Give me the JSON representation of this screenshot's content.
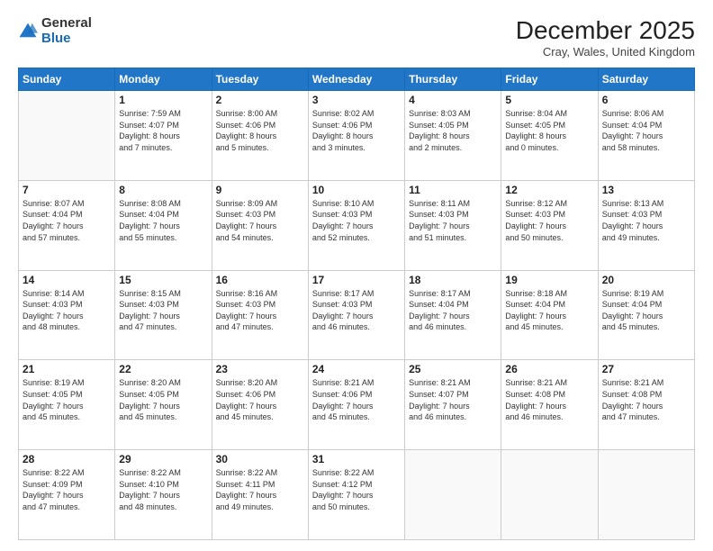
{
  "logo": {
    "general": "General",
    "blue": "Blue"
  },
  "title": "December 2025",
  "subtitle": "Cray, Wales, United Kingdom",
  "headers": [
    "Sunday",
    "Monday",
    "Tuesday",
    "Wednesday",
    "Thursday",
    "Friday",
    "Saturday"
  ],
  "weeks": [
    [
      {
        "day": "",
        "info": ""
      },
      {
        "day": "1",
        "info": "Sunrise: 7:59 AM\nSunset: 4:07 PM\nDaylight: 8 hours\nand 7 minutes."
      },
      {
        "day": "2",
        "info": "Sunrise: 8:00 AM\nSunset: 4:06 PM\nDaylight: 8 hours\nand 5 minutes."
      },
      {
        "day": "3",
        "info": "Sunrise: 8:02 AM\nSunset: 4:06 PM\nDaylight: 8 hours\nand 3 minutes."
      },
      {
        "day": "4",
        "info": "Sunrise: 8:03 AM\nSunset: 4:05 PM\nDaylight: 8 hours\nand 2 minutes."
      },
      {
        "day": "5",
        "info": "Sunrise: 8:04 AM\nSunset: 4:05 PM\nDaylight: 8 hours\nand 0 minutes."
      },
      {
        "day": "6",
        "info": "Sunrise: 8:06 AM\nSunset: 4:04 PM\nDaylight: 7 hours\nand 58 minutes."
      }
    ],
    [
      {
        "day": "7",
        "info": "Sunrise: 8:07 AM\nSunset: 4:04 PM\nDaylight: 7 hours\nand 57 minutes."
      },
      {
        "day": "8",
        "info": "Sunrise: 8:08 AM\nSunset: 4:04 PM\nDaylight: 7 hours\nand 55 minutes."
      },
      {
        "day": "9",
        "info": "Sunrise: 8:09 AM\nSunset: 4:03 PM\nDaylight: 7 hours\nand 54 minutes."
      },
      {
        "day": "10",
        "info": "Sunrise: 8:10 AM\nSunset: 4:03 PM\nDaylight: 7 hours\nand 52 minutes."
      },
      {
        "day": "11",
        "info": "Sunrise: 8:11 AM\nSunset: 4:03 PM\nDaylight: 7 hours\nand 51 minutes."
      },
      {
        "day": "12",
        "info": "Sunrise: 8:12 AM\nSunset: 4:03 PM\nDaylight: 7 hours\nand 50 minutes."
      },
      {
        "day": "13",
        "info": "Sunrise: 8:13 AM\nSunset: 4:03 PM\nDaylight: 7 hours\nand 49 minutes."
      }
    ],
    [
      {
        "day": "14",
        "info": "Sunrise: 8:14 AM\nSunset: 4:03 PM\nDaylight: 7 hours\nand 48 minutes."
      },
      {
        "day": "15",
        "info": "Sunrise: 8:15 AM\nSunset: 4:03 PM\nDaylight: 7 hours\nand 47 minutes."
      },
      {
        "day": "16",
        "info": "Sunrise: 8:16 AM\nSunset: 4:03 PM\nDaylight: 7 hours\nand 47 minutes."
      },
      {
        "day": "17",
        "info": "Sunrise: 8:17 AM\nSunset: 4:03 PM\nDaylight: 7 hours\nand 46 minutes."
      },
      {
        "day": "18",
        "info": "Sunrise: 8:17 AM\nSunset: 4:04 PM\nDaylight: 7 hours\nand 46 minutes."
      },
      {
        "day": "19",
        "info": "Sunrise: 8:18 AM\nSunset: 4:04 PM\nDaylight: 7 hours\nand 45 minutes."
      },
      {
        "day": "20",
        "info": "Sunrise: 8:19 AM\nSunset: 4:04 PM\nDaylight: 7 hours\nand 45 minutes."
      }
    ],
    [
      {
        "day": "21",
        "info": "Sunrise: 8:19 AM\nSunset: 4:05 PM\nDaylight: 7 hours\nand 45 minutes."
      },
      {
        "day": "22",
        "info": "Sunrise: 8:20 AM\nSunset: 4:05 PM\nDaylight: 7 hours\nand 45 minutes."
      },
      {
        "day": "23",
        "info": "Sunrise: 8:20 AM\nSunset: 4:06 PM\nDaylight: 7 hours\nand 45 minutes."
      },
      {
        "day": "24",
        "info": "Sunrise: 8:21 AM\nSunset: 4:06 PM\nDaylight: 7 hours\nand 45 minutes."
      },
      {
        "day": "25",
        "info": "Sunrise: 8:21 AM\nSunset: 4:07 PM\nDaylight: 7 hours\nand 46 minutes."
      },
      {
        "day": "26",
        "info": "Sunrise: 8:21 AM\nSunset: 4:08 PM\nDaylight: 7 hours\nand 46 minutes."
      },
      {
        "day": "27",
        "info": "Sunrise: 8:21 AM\nSunset: 4:08 PM\nDaylight: 7 hours\nand 47 minutes."
      }
    ],
    [
      {
        "day": "28",
        "info": "Sunrise: 8:22 AM\nSunset: 4:09 PM\nDaylight: 7 hours\nand 47 minutes."
      },
      {
        "day": "29",
        "info": "Sunrise: 8:22 AM\nSunset: 4:10 PM\nDaylight: 7 hours\nand 48 minutes."
      },
      {
        "day": "30",
        "info": "Sunrise: 8:22 AM\nSunset: 4:11 PM\nDaylight: 7 hours\nand 49 minutes."
      },
      {
        "day": "31",
        "info": "Sunrise: 8:22 AM\nSunset: 4:12 PM\nDaylight: 7 hours\nand 50 minutes."
      },
      {
        "day": "",
        "info": ""
      },
      {
        "day": "",
        "info": ""
      },
      {
        "day": "",
        "info": ""
      }
    ]
  ]
}
